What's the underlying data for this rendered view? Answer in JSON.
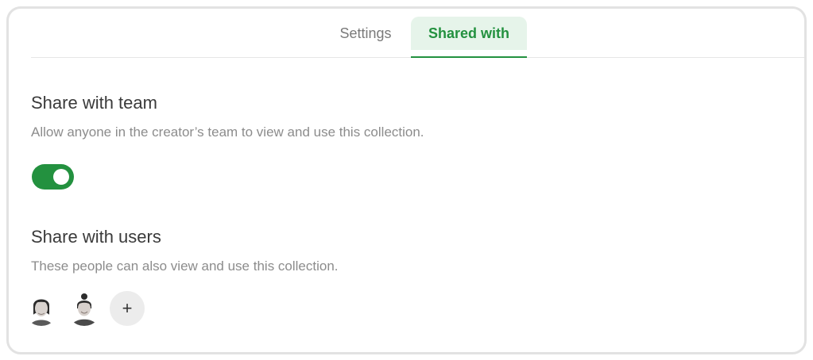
{
  "tabs": {
    "settings_label": "Settings",
    "shared_with_label": "Shared with",
    "active": "Shared with"
  },
  "team_section": {
    "title": "Share with team",
    "description": "Allow anyone in the creator’s team to view and use this collection.",
    "toggle_on": true
  },
  "users_section": {
    "title": "Share with users",
    "description": "These people can also view and use this collection.",
    "users": [
      {
        "avatar_icon": "user-avatar-1"
      },
      {
        "avatar_icon": "user-avatar-2"
      }
    ],
    "add_label": "+"
  },
  "colors": {
    "accent": "#23913f",
    "tab_active_bg": "#e6f4ea",
    "border": "#e2e2e2"
  }
}
